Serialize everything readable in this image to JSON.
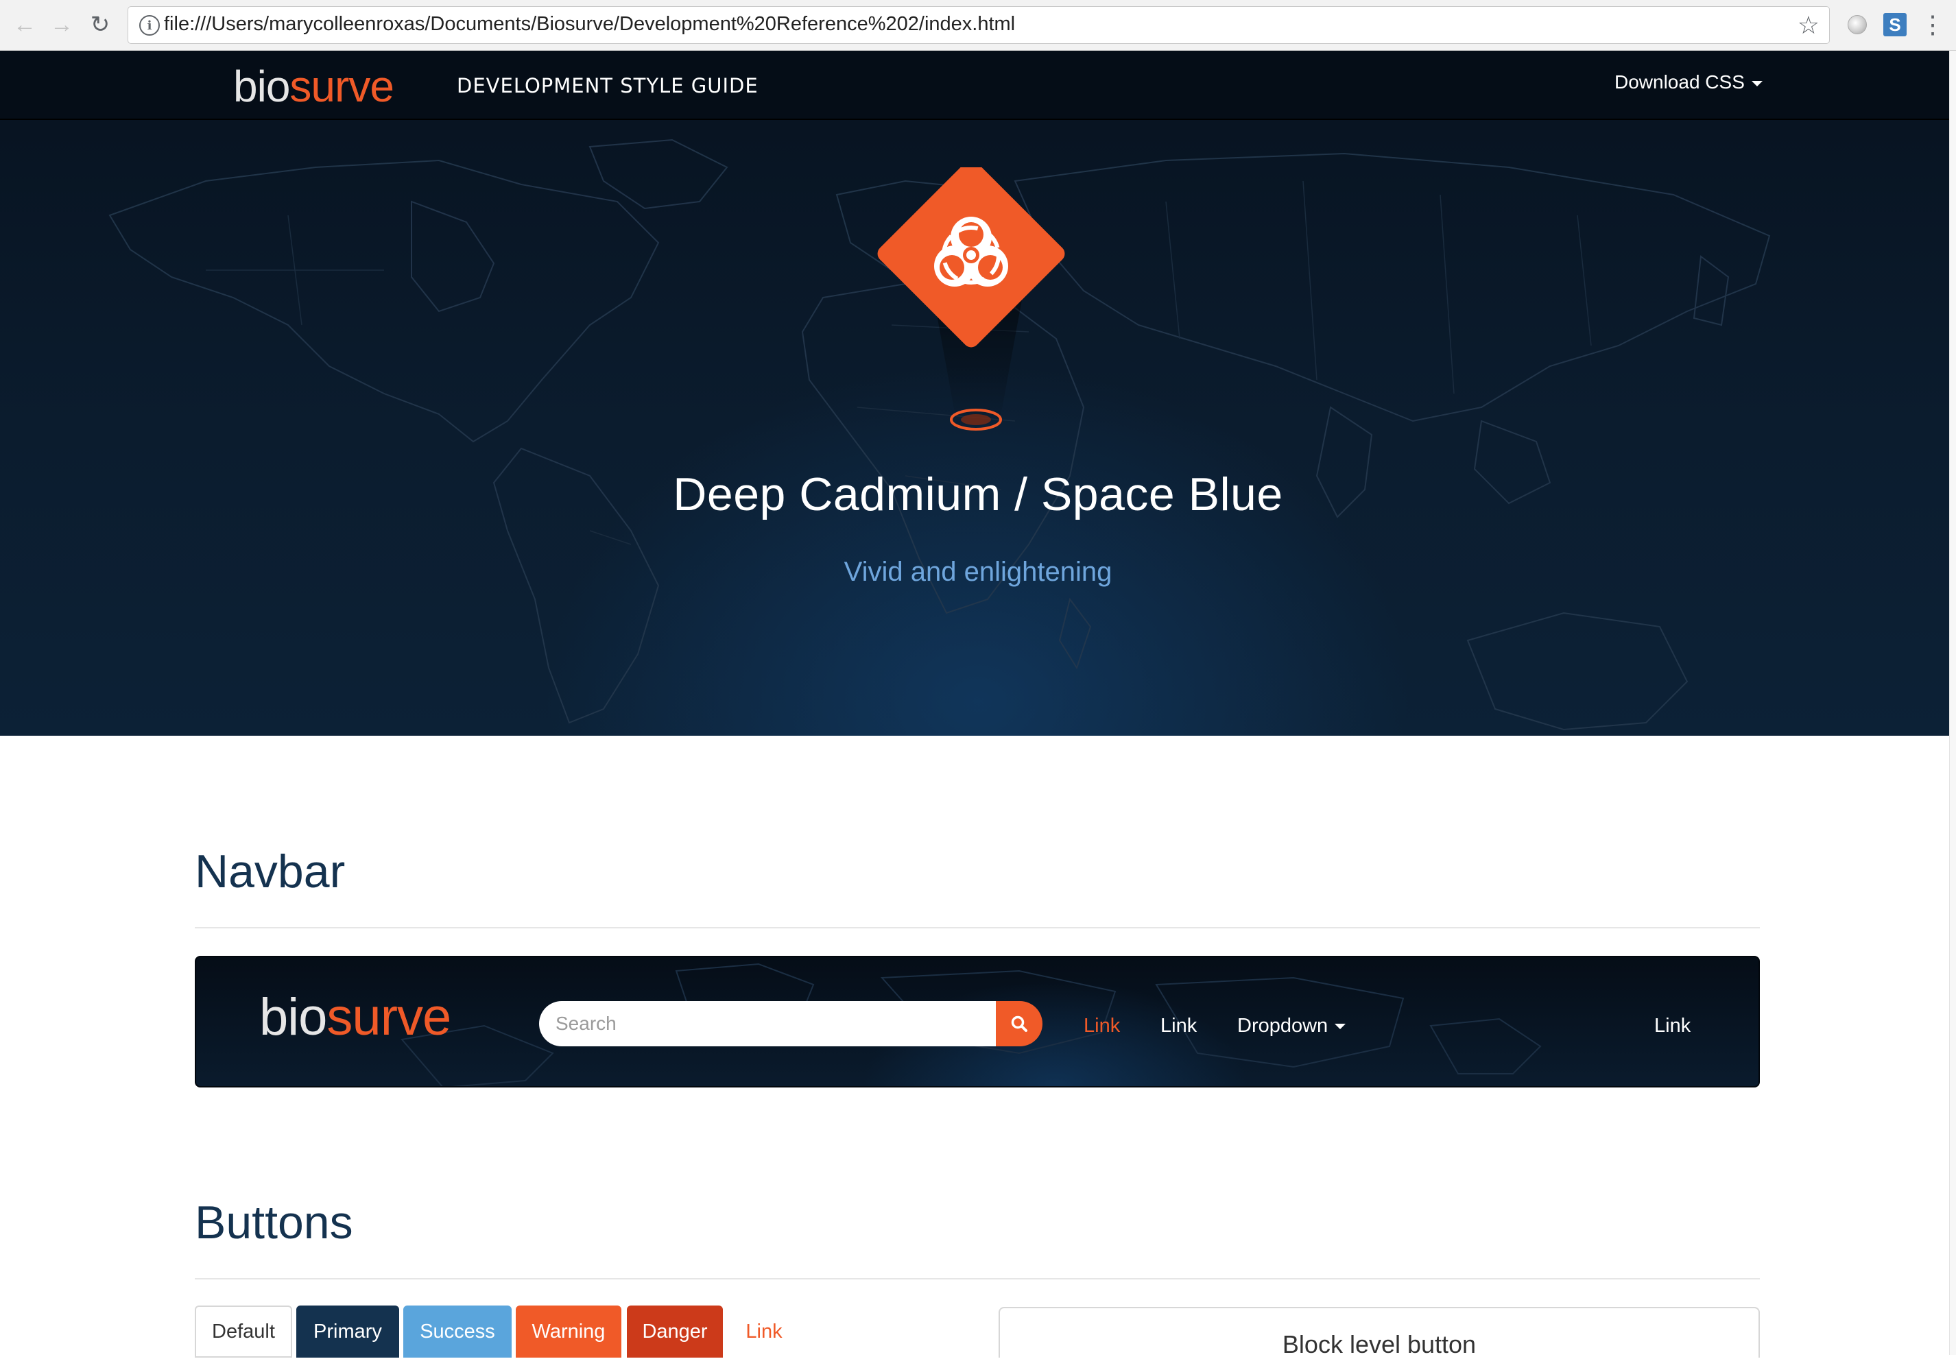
{
  "browser": {
    "url": "file:///Users/marycolleenroxas/Documents/Biosurve/Development%20Reference%202/index.html"
  },
  "topnav": {
    "brand_bio": "bio",
    "brand_surve": "surve",
    "title": "DEVELOPMENT STYLE GUIDE",
    "download": "Download CSS"
  },
  "hero": {
    "title": "Deep Cadmium / Space Blue",
    "subtitle": "Vivid and enlightening"
  },
  "sections": {
    "navbar_title": "Navbar",
    "buttons_title": "Buttons"
  },
  "demo_navbar": {
    "brand_bio": "bio",
    "brand_surve": "surve",
    "search_placeholder": "Search",
    "link_active": "Link",
    "link_2": "Link",
    "dropdown": "Dropdown",
    "link_right": "Link"
  },
  "buttons": {
    "default": "Default",
    "primary": "Primary",
    "success": "Success",
    "warning": "Warning",
    "danger": "Danger",
    "link": "Link",
    "block": "Block level button"
  },
  "colors": {
    "cadmium": "#f05a28",
    "space_blue": "#14324f",
    "success": "#5aa5dc",
    "danger": "#cc3a1a"
  }
}
